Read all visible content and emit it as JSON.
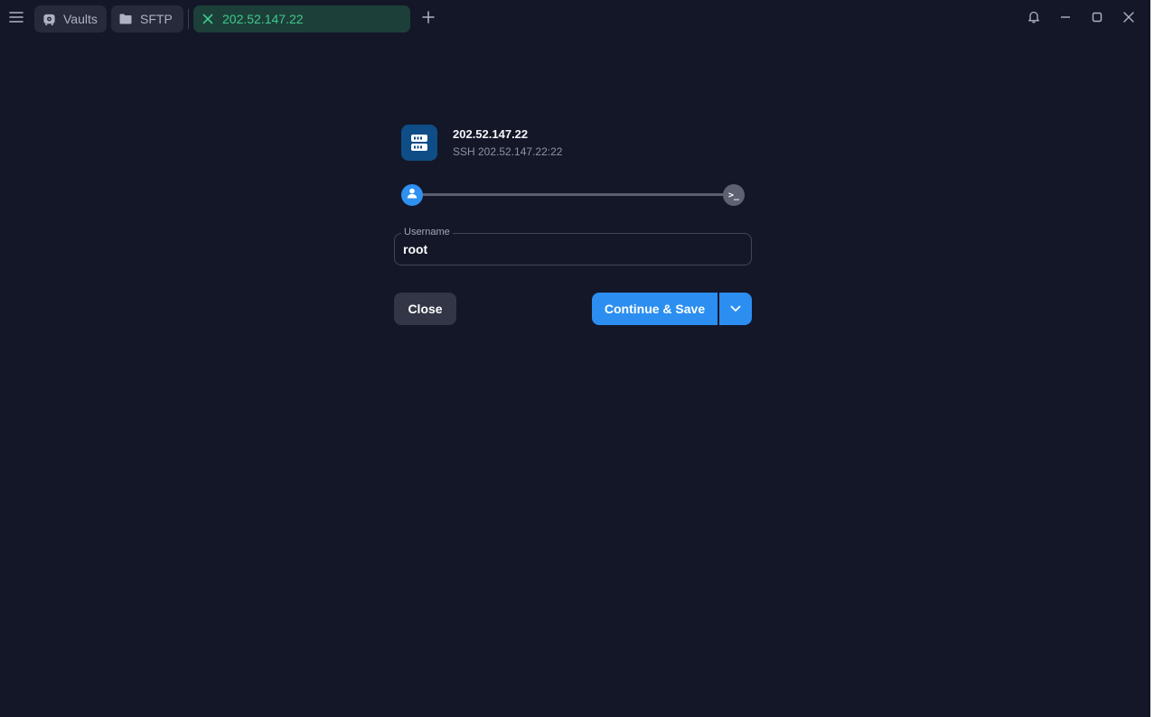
{
  "tabs": {
    "vaults": {
      "label": "Vaults",
      "icon": "vault-icon"
    },
    "sftp": {
      "label": "SFTP",
      "icon": "folder-icon"
    },
    "host": {
      "label": "202.52.147.22",
      "icon": "close-icon",
      "color": "#3ec98c"
    }
  },
  "window_controls": [
    "bell-icon",
    "minimize-icon",
    "maximize-icon",
    "close-icon"
  ],
  "host": {
    "title": "202.52.147.22",
    "subtitle": "SSH 202.52.147.22:22",
    "icon": "server-icon"
  },
  "steps": {
    "current": "user-icon",
    "next_glyph": ">_"
  },
  "username": {
    "label": "Username",
    "value": "root"
  },
  "actions": {
    "close_label": "Close",
    "continue_label": "Continue & Save",
    "accent": "#2b8ef0"
  }
}
